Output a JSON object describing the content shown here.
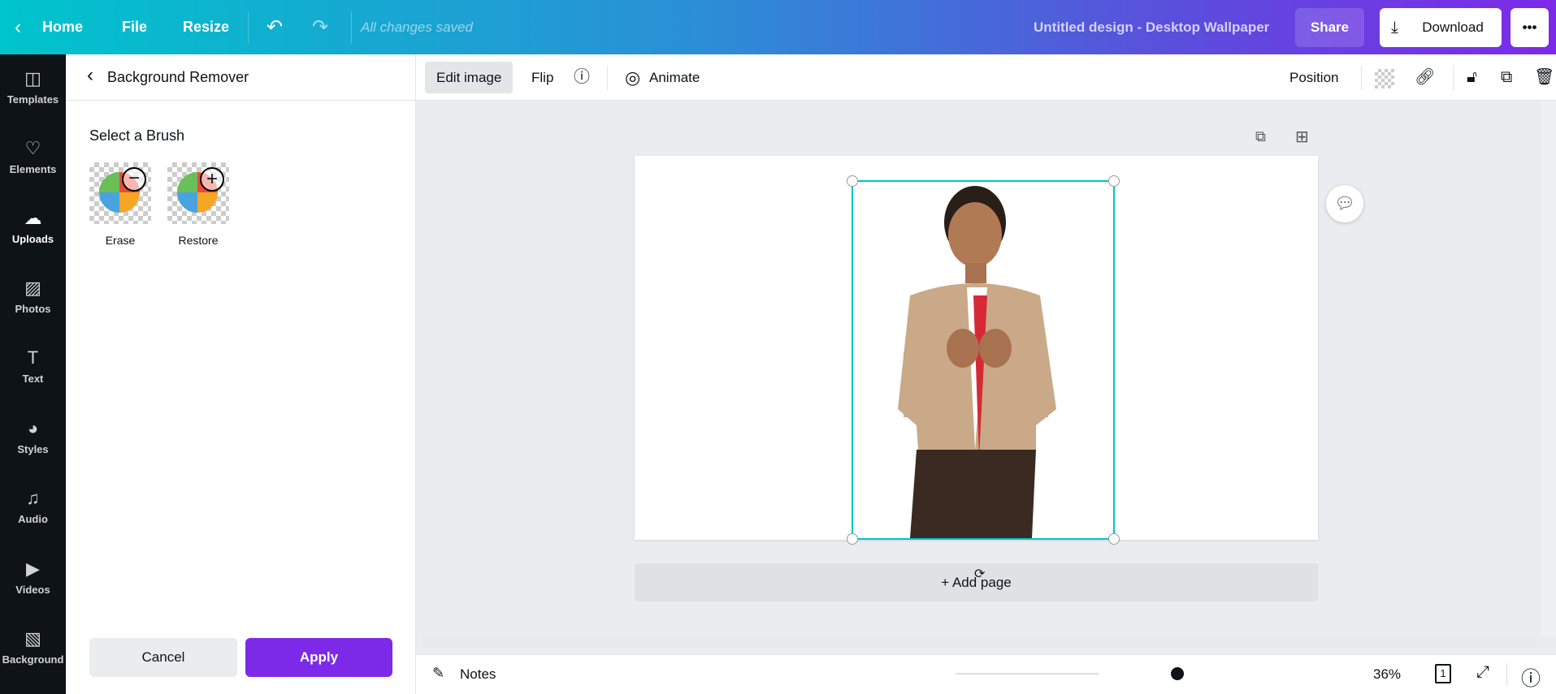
{
  "topbar": {
    "home": "Home",
    "file": "File",
    "resize": "Resize",
    "save_status": "All changes saved",
    "doc_title": "Untitled design - Desktop Wallpaper",
    "share": "Share",
    "download": "Download",
    "more": "•••"
  },
  "sidebar": {
    "items": [
      {
        "label": "Templates",
        "icon": "templates-icon"
      },
      {
        "label": "Elements",
        "icon": "elements-icon"
      },
      {
        "label": "Uploads",
        "icon": "upload-icon"
      },
      {
        "label": "Photos",
        "icon": "photos-icon"
      },
      {
        "label": "Text",
        "icon": "text-icon"
      },
      {
        "label": "Styles",
        "icon": "palette-icon"
      },
      {
        "label": "Audio",
        "icon": "music-icon"
      },
      {
        "label": "Videos",
        "icon": "video-icon"
      },
      {
        "label": "Background",
        "icon": "background-icon"
      }
    ],
    "active": "Uploads"
  },
  "panel": {
    "title": "Background Remover",
    "section": "Select a Brush",
    "brushes": [
      {
        "label": "Erase"
      },
      {
        "label": "Restore"
      }
    ],
    "cancel": "Cancel",
    "apply": "Apply"
  },
  "toolbar": {
    "edit_image": "Edit image",
    "flip": "Flip",
    "animate": "Animate",
    "position": "Position"
  },
  "canvas": {
    "add_page": "+ Add page"
  },
  "bottombar": {
    "notes": "Notes",
    "zoom": "36%",
    "zoom_level_percent": 36,
    "page_count": "1"
  },
  "colors": {
    "accent": "#7d2ae8",
    "selection": "#00c4cc",
    "sidebar": "#0e1318"
  }
}
